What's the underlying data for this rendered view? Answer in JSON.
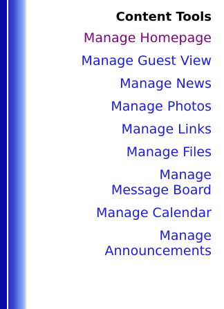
{
  "heading": "Content Tools",
  "colors": {
    "link": "#1a1ae6",
    "visited_link": "#800080",
    "bar_dark": "#0a0aa8",
    "bar_light": "#a9c2f7"
  },
  "items": [
    {
      "label": "Manage Homepage",
      "state": "visited"
    },
    {
      "label": "Manage Guest View",
      "state": "link"
    },
    {
      "label": "Manage News",
      "state": "link"
    },
    {
      "label": "Manage Photos",
      "state": "link"
    },
    {
      "label": "Manage Links",
      "state": "link"
    },
    {
      "label": "Manage Files",
      "state": "link"
    },
    {
      "line1": "Manage",
      "line2": "Message Board",
      "state": "link"
    },
    {
      "label": "Manage Calendar",
      "state": "link"
    },
    {
      "line1": "Manage",
      "line2": "Announcements",
      "state": "link"
    }
  ]
}
